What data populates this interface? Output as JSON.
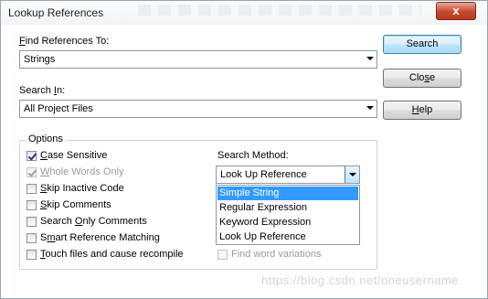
{
  "window": {
    "title": "Lookup References",
    "close_glyph": "x"
  },
  "find": {
    "label_prefix": "",
    "label_accel": "F",
    "label_rest": "ind References To:",
    "value": "Strings"
  },
  "search_in": {
    "label_prefix": "Search ",
    "label_accel": "I",
    "label_rest": "n:",
    "value": "All Project Files"
  },
  "buttons": {
    "search": "Search",
    "close_prefix": "Clo",
    "close_accel": "s",
    "close_rest": "e",
    "help_accel": "H",
    "help_rest": "elp"
  },
  "options": {
    "legend": "Options",
    "items": [
      {
        "prefix": "",
        "accel": "C",
        "rest": "ase Sensitive",
        "checked": true,
        "disabled": false
      },
      {
        "prefix": "",
        "accel": "W",
        "rest": "hole Words Only",
        "checked": true,
        "disabled": true
      },
      {
        "prefix": "",
        "accel": "S",
        "rest": "kip Inactive Code",
        "checked": false,
        "disabled": false
      },
      {
        "prefix": "",
        "accel": "S",
        "rest": "kip Comments",
        "checked": false,
        "disabled": false
      },
      {
        "prefix": "Search ",
        "accel": "O",
        "rest": "nly Comments",
        "checked": false,
        "disabled": false
      },
      {
        "prefix": "S",
        "accel": "m",
        "rest": "art Reference Matching",
        "checked": false,
        "disabled": false
      },
      {
        "prefix": "",
        "accel": "T",
        "rest": "ouch files and cause recompile",
        "checked": false,
        "disabled": false
      }
    ]
  },
  "search_method": {
    "label": "Search Method:",
    "value": "Look Up Reference",
    "options": [
      "Simple String",
      "Regular Expression",
      "Keyword Expression",
      "Look Up Reference"
    ],
    "highlighted": "Simple String"
  },
  "find_variations": {
    "label": "Find word variations",
    "checked": false,
    "disabled": true
  },
  "watermark": "https://blog.csdn.net/oneusername"
}
